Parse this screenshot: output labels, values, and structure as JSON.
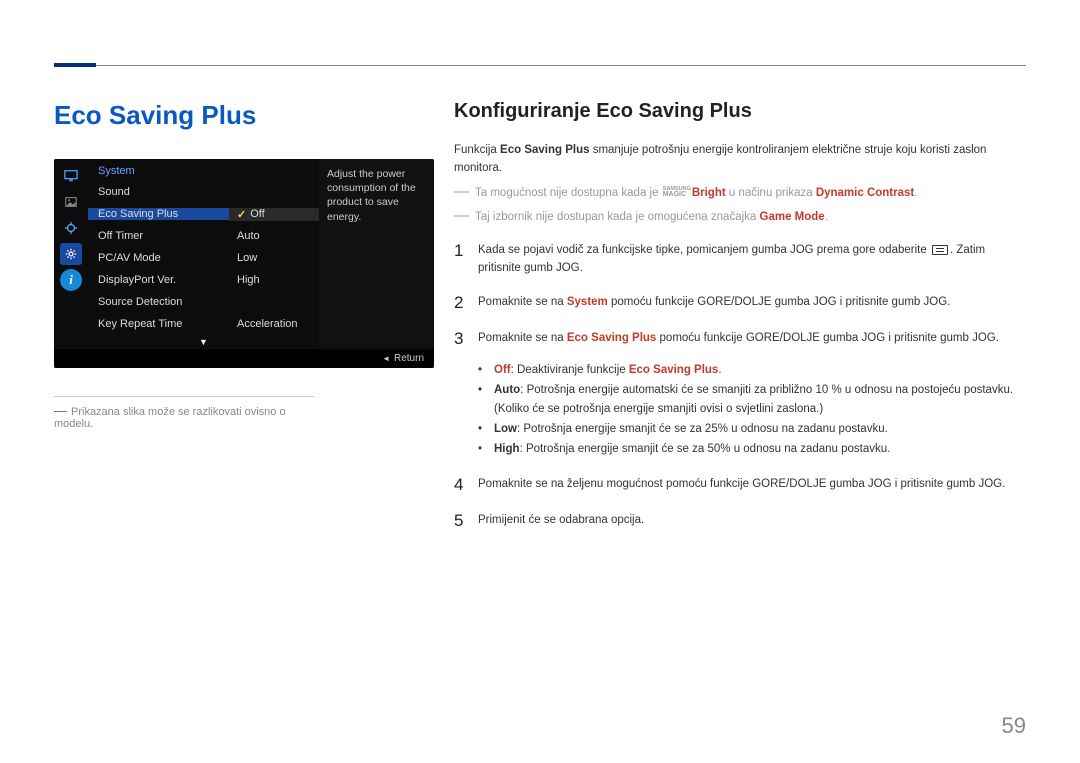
{
  "page_number": "59",
  "heading_left": "Eco Saving Plus",
  "heading_right": "Konfiguriranje Eco Saving Plus",
  "osd": {
    "section": "System",
    "items": [
      {
        "label": "Sound",
        "value": ""
      },
      {
        "label": "Eco Saving Plus",
        "value": "Off",
        "selected": true
      },
      {
        "label": "Off Timer",
        "value": "Auto"
      },
      {
        "label": "PC/AV Mode",
        "value": "Low"
      },
      {
        "label": "DisplayPort Ver.",
        "value": "High"
      },
      {
        "label": "Source Detection",
        "value": ""
      },
      {
        "label": "Key Repeat Time",
        "value": "Acceleration"
      }
    ],
    "desc1": "Adjust the power consumption of the product to save energy.",
    "return": "Return"
  },
  "left_note": "Prikazana slika može se razlikovati ovisno o modelu.",
  "intro": {
    "lead1a": "Funkcija ",
    "lead1b": "Eco Saving Plus",
    "lead1c": " smanjuje potrošnju energije kontroliranjem električne struje koju koristi zaslon monitora.",
    "g1a": "Ta mogućnost nije dostupna kada je ",
    "g1b": "Bright",
    "g1c": " u načinu prikaza ",
    "g1d": "Dynamic Contrast",
    "g2a": "Taj izbornik nije dostupan kada je omogućena značajka ",
    "g2b": "Game Mode"
  },
  "steps": {
    "s1a": "Kada se pojavi vodič za funkcijske tipke, pomicanjem gumba JOG prema gore odaberite ",
    "s1b": ". Zatim pritisnite gumb JOG.",
    "s2a": "Pomaknite se na ",
    "s2b": "System",
    "s2c": " pomoću funkcije GORE/DOLJE gumba JOG i pritisnite gumb JOG.",
    "s3a": "Pomaknite se na ",
    "s3b": "Eco Saving Plus",
    "s3c": " pomoću funkcije GORE/DOLJE gumba JOG i pritisnite gumb JOG.",
    "s4": "Pomaknite se na željenu mogućnost pomoću funkcije GORE/DOLJE gumba JOG i pritisnite gumb JOG.",
    "s5": "Primijenit će se odabrana opcija."
  },
  "bullets": {
    "b1a": "Off",
    "b1b": ": Deaktiviranje funkcije ",
    "b1c": "Eco Saving Plus",
    "b2a": "Auto",
    "b2b": ": Potrošnja energije automatski će se smanjiti za približno 10 % u odnosu na postojeću postavku.",
    "b2sub": "(Koliko će se potrošnja energije smanjiti ovisi o svjetlini zaslona.)",
    "b3a": "Low",
    "b3b": ": Potrošnja energije smanjit će se za 25% u odnosu na zadanu postavku.",
    "b4a": "High",
    "b4b": ": Potrošnja energije smanjit će se za 50% u odnosu na zadanu postavku."
  }
}
